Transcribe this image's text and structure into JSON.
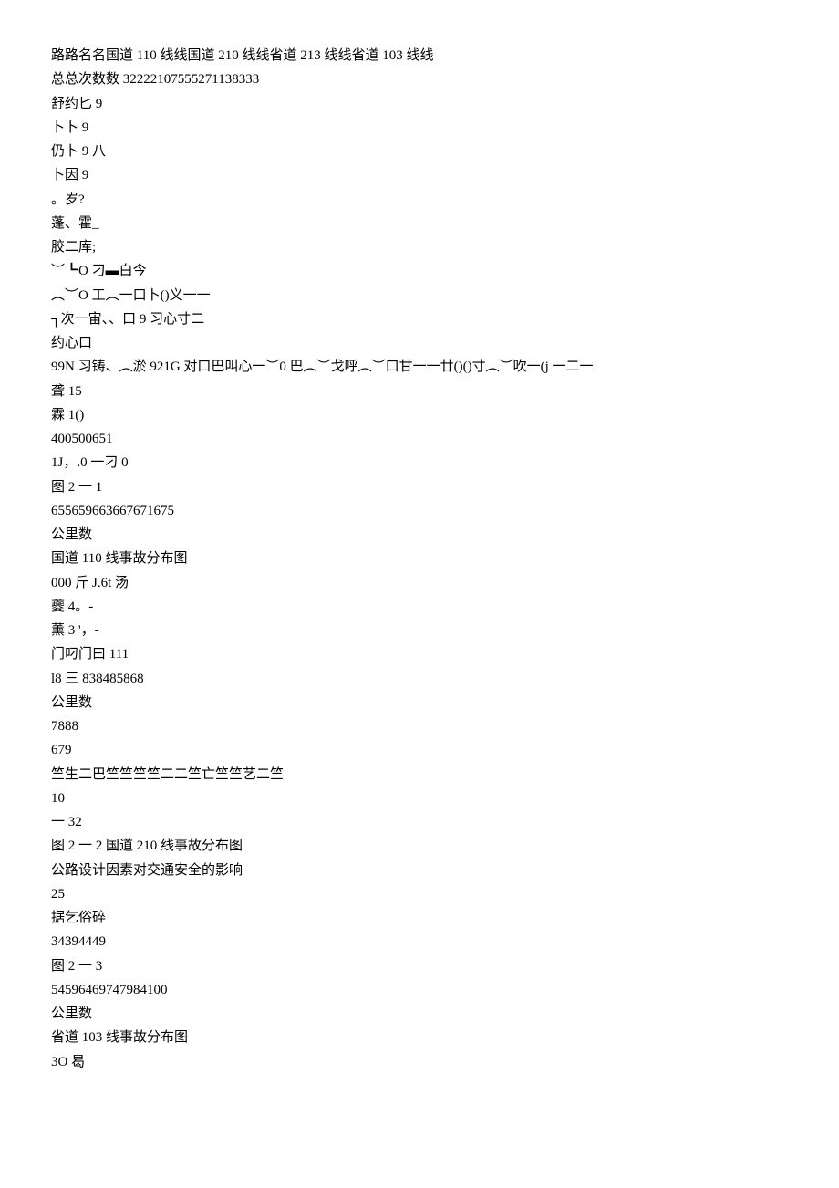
{
  "lines": [
    "路路名名国道 110 线线国道 210 线线省道 213 线线省道 103 线线",
    "总总次数数 32222107555271138333",
    "舒约匕 9",
    "卜卜 9",
    "仍卜 9 八",
    "卜因 9",
    "。岁?",
    "蓬、霍_",
    "胶二库;",
    "︶┗O 刁▬白今",
    "︵︶O 工︵一口卜()义一一",
    "┐次一宙、、口 9 习心寸二",
    "约心口",
    "99N 习铸、︵淤 921G 对口巴叫心一︶0 巴︵︶戈呼︵︶口甘一一廿()()寸︵︶吹一(j 一二一",
    "聋 15",
    "霖 1()",
    "400500651",
    "1J，.0 一刁 0",
    "图 2 一 1",
    "655659663667671675",
    "公里数",
    "国道 110 线事故分布图",
    "000 斤 J.6t 汤",
    "夔 4。-",
    "薰 3 '，-",
    "门叼门曰 111",
    "l8 三 838485868",
    "公里数",
    "7888",
    "679",
    "竺生二巴竺竺竺竺二二竺亡竺竺艺二竺",
    "10",
    "一 32",
    "图 2 一 2 国道 210 线事故分布图",
    "公路设计因素对交通安全的影响",
    "25",
    "据乞俗碎",
    "34394449",
    "图 2 一 3",
    "54596469747984100",
    "公里数",
    "省道 103 线事故分布图",
    "3O 曷"
  ]
}
